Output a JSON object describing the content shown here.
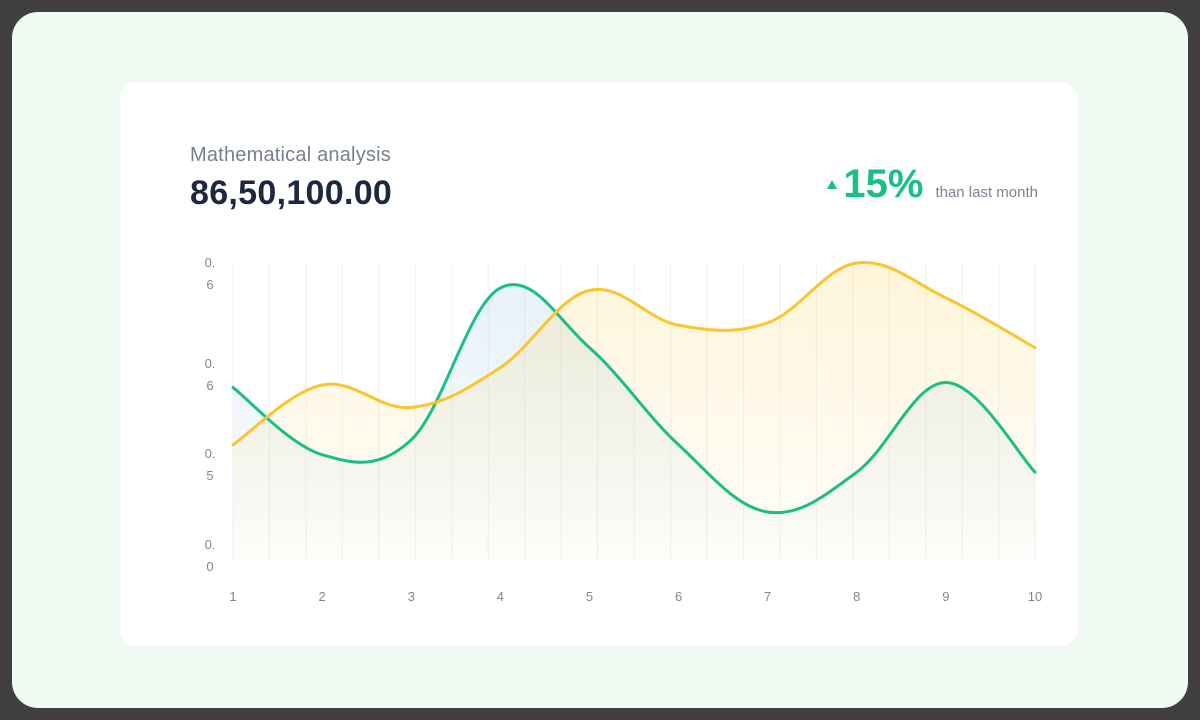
{
  "header": {
    "title": "Mathematical analysis",
    "value": "86,50,100.00"
  },
  "trend": {
    "percent": "15%",
    "text": "than last month",
    "direction": "up"
  },
  "colors": {
    "green": "#1abf86",
    "yellow": "#fbc52d",
    "background": "#eefaf2",
    "card": "#ffffff"
  },
  "chart_data": {
    "type": "area",
    "x": [
      1,
      2,
      3,
      4,
      5,
      6,
      7,
      8,
      9,
      10
    ],
    "y_tick_labels": [
      [
        "0.",
        "6"
      ],
      [
        "0.",
        "6"
      ],
      [
        "0.",
        "5"
      ],
      [
        "0.",
        "0"
      ]
    ],
    "series": [
      {
        "color": "#1abf86",
        "values": [
          0.5,
          0.23,
          0.29,
          0.9,
          0.66,
          0.27,
          0.0,
          0.16,
          0.52,
          0.16
        ]
      },
      {
        "color": "#fbc52d",
        "values": [
          0.27,
          0.51,
          0.42,
          0.58,
          0.89,
          0.75,
          0.76,
          1.0,
          0.86,
          0.66
        ]
      }
    ],
    "grid": true,
    "gridlines": "vertical"
  }
}
